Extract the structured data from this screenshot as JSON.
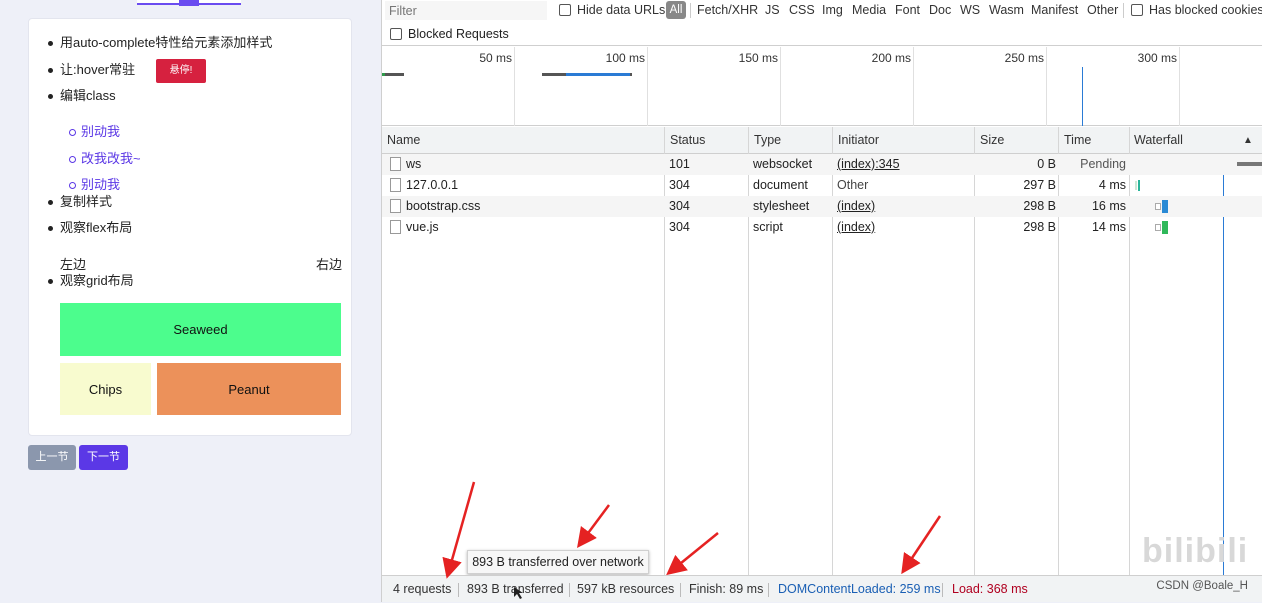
{
  "left": {
    "list": [
      "用auto-complete特性给元素添加样式",
      "让:hover常驻",
      "编辑class",
      "复制样式",
      "观察flex布局",
      "观察grid布局"
    ],
    "hover_button": "悬停!",
    "sublist": [
      "别动我",
      "改我改我~",
      "别动我"
    ],
    "flex_left": "左边",
    "flex_right": "右边",
    "grid": [
      "Seaweed",
      "Chips",
      "Peanut"
    ],
    "prev": "上一节",
    "next": "下一节"
  },
  "devtools": {
    "filter_placeholder": "Filter",
    "hide_data_urls": "Hide data URLs",
    "types": [
      "All",
      "Fetch/XHR",
      "JS",
      "CSS",
      "Img",
      "Media",
      "Font",
      "Doc",
      "WS",
      "Wasm",
      "Manifest",
      "Other"
    ],
    "has_blocked_cookies": "Has blocked cookies",
    "blocked_requests": "Blocked Requests",
    "overview_ticks": [
      "50 ms",
      "100 ms",
      "150 ms",
      "200 ms",
      "250 ms",
      "300 ms"
    ],
    "columns": [
      "Name",
      "Status",
      "Type",
      "Initiator",
      "Size",
      "Time",
      "Waterfall"
    ],
    "sort_indicator": "▲",
    "rows": [
      {
        "name": "ws",
        "status": "101",
        "type": "websocket",
        "initiator": "(index):345",
        "size": "0 B",
        "time": "Pending"
      },
      {
        "name": "127.0.0.1",
        "status": "304",
        "type": "document",
        "initiator": "Other",
        "size": "297 B",
        "time": "4 ms"
      },
      {
        "name": "bootstrap.css",
        "status": "304",
        "type": "stylesheet",
        "initiator": "(index)",
        "size": "298 B",
        "time": "16 ms"
      },
      {
        "name": "vue.js",
        "status": "304",
        "type": "script",
        "initiator": "(index)",
        "size": "298 B",
        "time": "14 ms"
      }
    ],
    "tooltip": "893 B transferred over network",
    "status": {
      "requests": "4 requests",
      "transferred": "893 B transferred",
      "resources": "597 kB resources",
      "finish": "Finish: 89 ms",
      "dcl": "DOMContentLoaded: 259 ms",
      "load": "Load: 368 ms"
    },
    "colors": {
      "dcl": "#1a5fb4",
      "load": "#b00020",
      "arrow": "#e52222"
    }
  },
  "watermark": "CSDN @Boale_H",
  "bili_logo": "bilibili"
}
